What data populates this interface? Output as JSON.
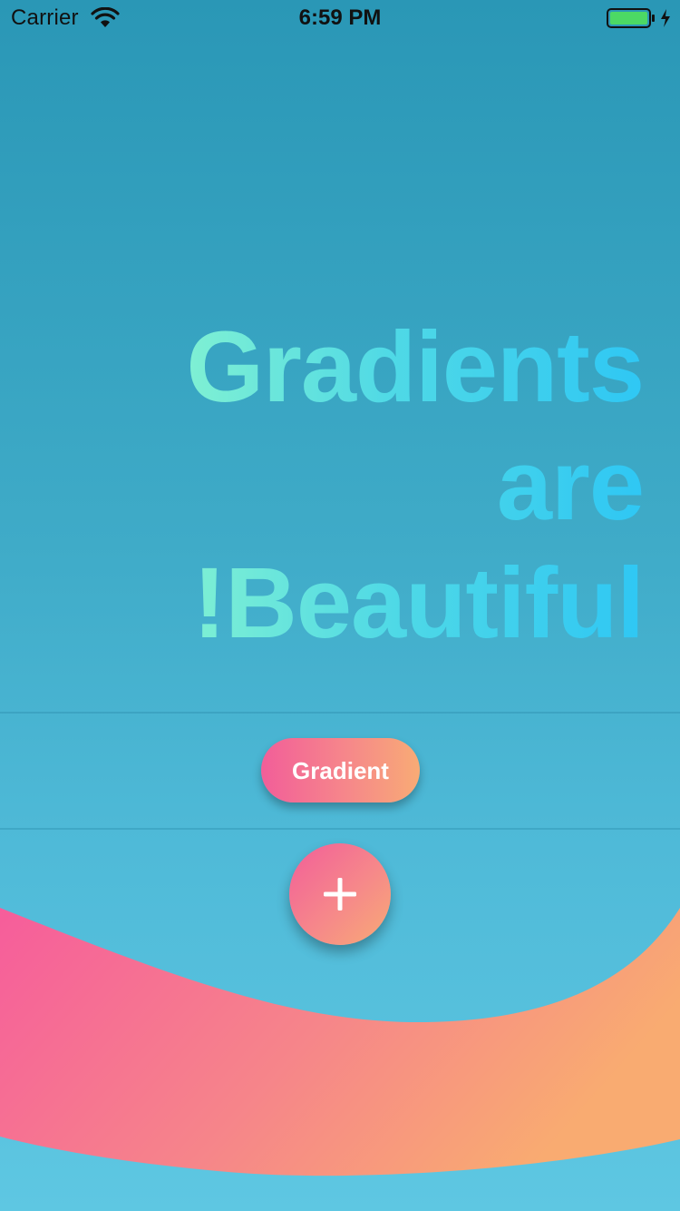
{
  "status_bar": {
    "carrier": "Carrier",
    "time": "6:59 PM",
    "wifi_icon": "wifi-icon",
    "battery_icon": "battery-charging-icon"
  },
  "headline": {
    "line1": "Gradients",
    "line2": "are",
    "line3": "!Beautiful"
  },
  "gradient_button": {
    "label": "Gradient"
  },
  "fab": {
    "icon": "plus-icon"
  },
  "colors": {
    "background_top": "#2a97b6",
    "background_bottom": "#5ec7e2",
    "headline_start": "#7ff0d3",
    "headline_end": "#2fc7f4",
    "accent_pink": "#f25e99",
    "accent_orange": "#f8ab75",
    "battery_fill": "#4cd964"
  }
}
